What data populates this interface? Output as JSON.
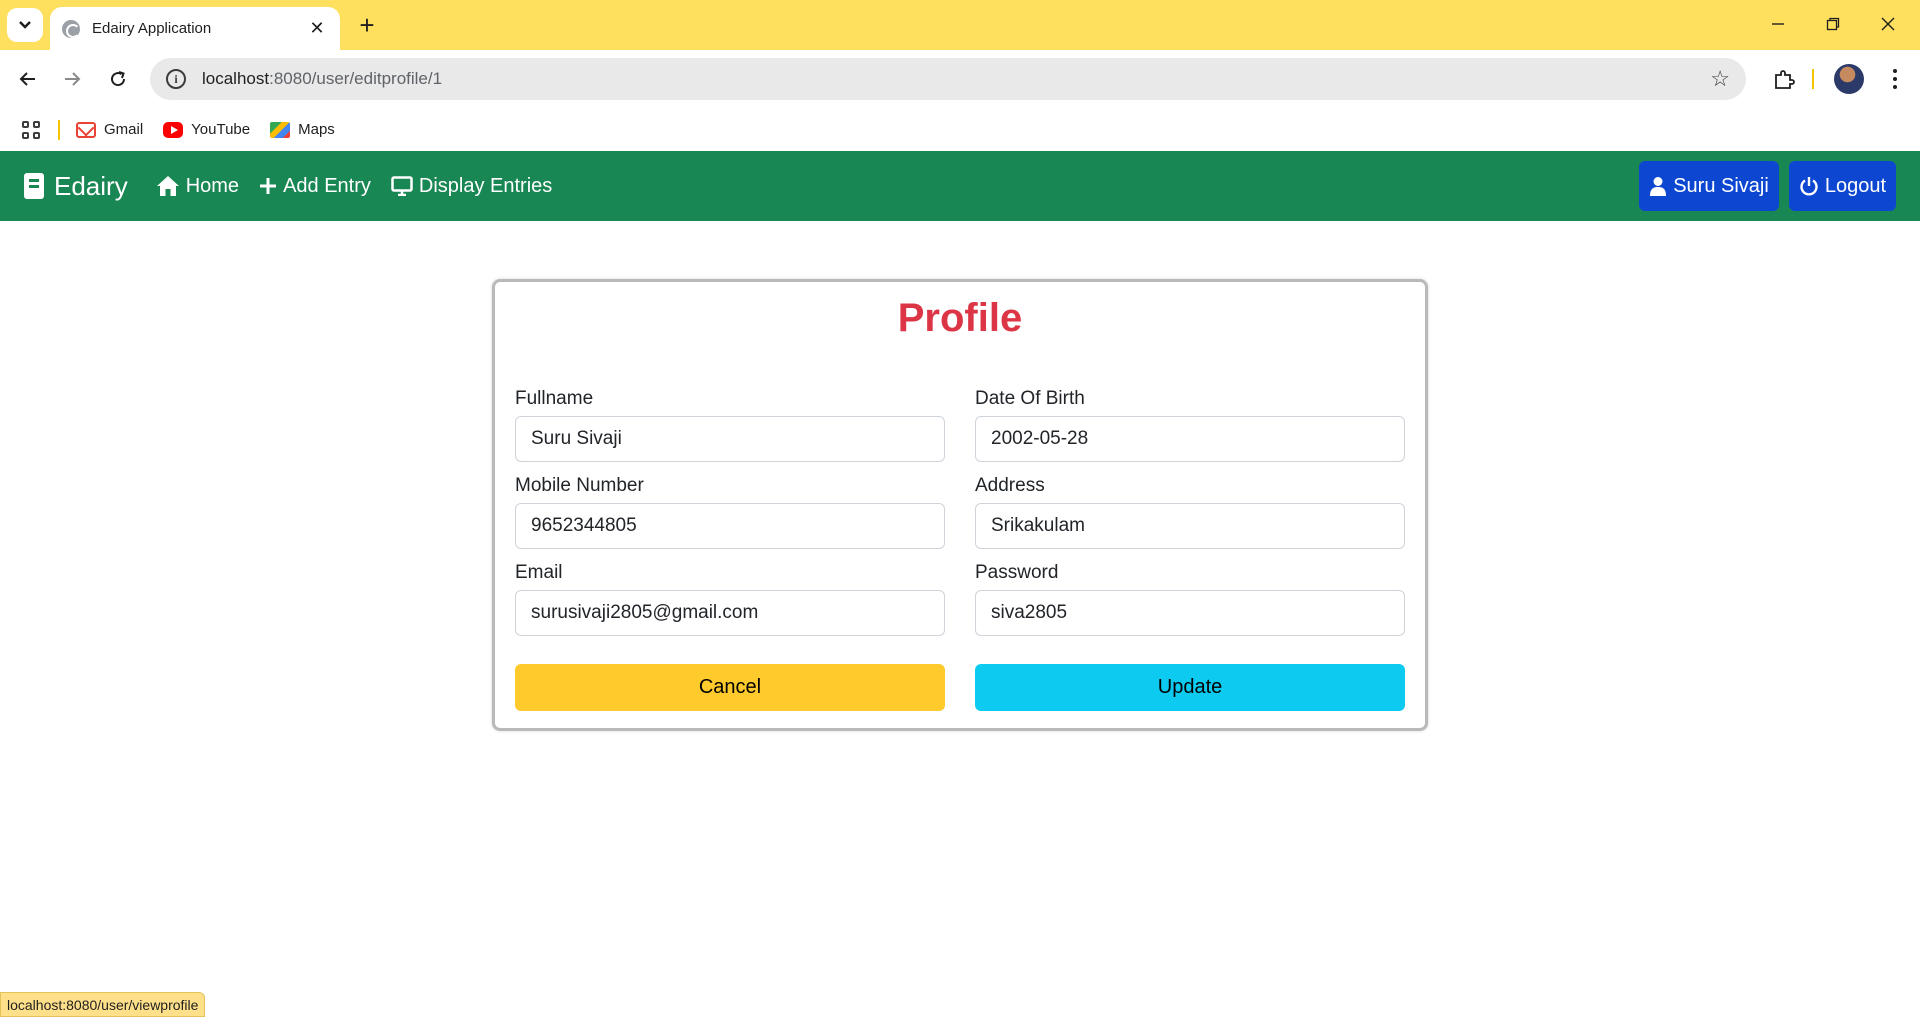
{
  "browser": {
    "tab_title": "Edairy Application",
    "new_tab_label": "+",
    "close_label": "✕",
    "url_host": "localhost",
    "url_path": ":8080/user/editprofile/1",
    "bookmarks": [
      {
        "label": "Gmail",
        "icon": "gmail-icon"
      },
      {
        "label": "YouTube",
        "icon": "youtube-icon"
      },
      {
        "label": "Maps",
        "icon": "maps-icon"
      }
    ],
    "status_url": "localhost:8080/user/viewprofile"
  },
  "navbar": {
    "brand": "Edairy",
    "links": [
      {
        "label": "Home",
        "icon": "home-icon"
      },
      {
        "label": "Add Entry",
        "icon": "plus-icon"
      },
      {
        "label": "Display Entries",
        "icon": "monitor-icon"
      }
    ],
    "user_label": "Suru Sivaji",
    "logout_label": "Logout",
    "bg_color": "#198754",
    "button_color": "#0d47d1"
  },
  "profile": {
    "title": "Profile",
    "fields": {
      "fullname": {
        "label": "Fullname",
        "value": "Suru Sivaji"
      },
      "dob": {
        "label": "Date Of Birth",
        "value": "2002-05-28"
      },
      "mobile": {
        "label": "Mobile Number",
        "value": "9652344805"
      },
      "address": {
        "label": "Address",
        "value": "Srikakulam"
      },
      "email": {
        "label": "Email",
        "value": "surusivaji2805@gmail.com"
      },
      "password": {
        "label": "Password",
        "value": "siva2805"
      }
    },
    "cancel_label": "Cancel",
    "update_label": "Update",
    "title_color": "#dc3545",
    "cancel_color": "#ffca2c",
    "update_color": "#0dcaf0"
  }
}
